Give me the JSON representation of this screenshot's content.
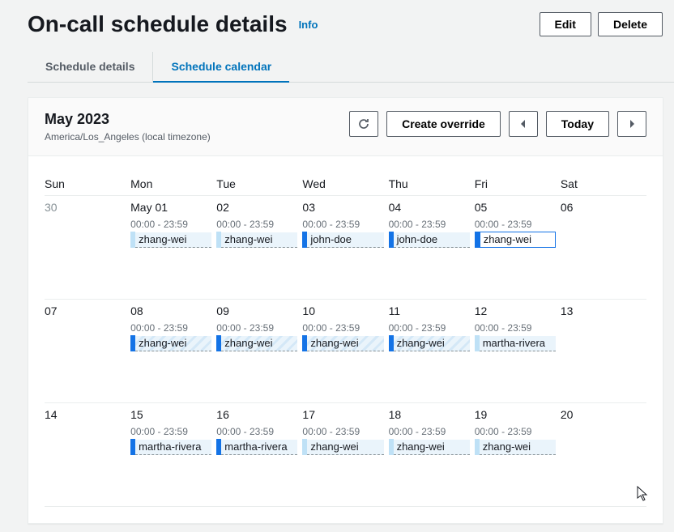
{
  "header": {
    "title": "On-call schedule details",
    "info_label": "Info",
    "edit_label": "Edit",
    "delete_label": "Delete"
  },
  "tabs": {
    "details": "Schedule details",
    "calendar": "Schedule calendar"
  },
  "toolbar": {
    "month": "May 2023",
    "timezone": "America/Los_Angeles (local timezone)",
    "create_override": "Create override",
    "today": "Today"
  },
  "day_headers": [
    "Sun",
    "Mon",
    "Tue",
    "Wed",
    "Thu",
    "Fri",
    "Sat"
  ],
  "weeks": [
    {
      "days": [
        {
          "label": "30",
          "muted": true
        },
        {
          "label": "May 01",
          "time": "00:00 - 23:59",
          "event": {
            "name": "zhang-wei",
            "style": "light",
            "bar": "light"
          }
        },
        {
          "label": "02",
          "time": "00:00 - 23:59",
          "event": {
            "name": "zhang-wei",
            "style": "light",
            "bar": "light"
          }
        },
        {
          "label": "03",
          "time": "00:00 - 23:59",
          "event": {
            "name": "john-doe",
            "style": "light",
            "bar": "blue"
          }
        },
        {
          "label": "04",
          "time": "00:00 - 23:59",
          "event": {
            "name": "john-doe",
            "style": "light",
            "bar": "blue"
          }
        },
        {
          "label": "05",
          "time": "00:00 - 23:59",
          "event": {
            "name": "zhang-wei",
            "style": "boxed",
            "bar": "blue"
          }
        },
        {
          "label": "06"
        }
      ]
    },
    {
      "days": [
        {
          "label": "07"
        },
        {
          "label": "08",
          "time": "00:00 - 23:59",
          "event": {
            "name": "zhang-wei",
            "style": "hatch",
            "bar": "blue"
          }
        },
        {
          "label": "09",
          "time": "00:00 - 23:59",
          "event": {
            "name": "zhang-wei",
            "style": "hatch",
            "bar": "blue"
          }
        },
        {
          "label": "10",
          "time": "00:00 - 23:59",
          "event": {
            "name": "zhang-wei",
            "style": "hatch",
            "bar": "blue"
          }
        },
        {
          "label": "11",
          "time": "00:00 - 23:59",
          "event": {
            "name": "zhang-wei",
            "style": "hatch",
            "bar": "blue"
          }
        },
        {
          "label": "12",
          "time": "00:00 - 23:59",
          "event": {
            "name": "martha-rivera",
            "style": "light",
            "bar": "light"
          }
        },
        {
          "label": "13"
        }
      ]
    },
    {
      "days": [
        {
          "label": "14"
        },
        {
          "label": "15",
          "time": "00:00 - 23:59",
          "event": {
            "name": "martha-rivera",
            "style": "light",
            "bar": "blue"
          }
        },
        {
          "label": "16",
          "time": "00:00 - 23:59",
          "event": {
            "name": "martha-rivera",
            "style": "light",
            "bar": "blue"
          }
        },
        {
          "label": "17",
          "time": "00:00 - 23:59",
          "event": {
            "name": "zhang-wei",
            "style": "light",
            "bar": "light"
          }
        },
        {
          "label": "18",
          "time": "00:00 - 23:59",
          "event": {
            "name": "zhang-wei",
            "style": "light",
            "bar": "light"
          }
        },
        {
          "label": "19",
          "time": "00:00 - 23:59",
          "event": {
            "name": "zhang-wei",
            "style": "light",
            "bar": "light"
          }
        },
        {
          "label": "20"
        }
      ]
    }
  ]
}
